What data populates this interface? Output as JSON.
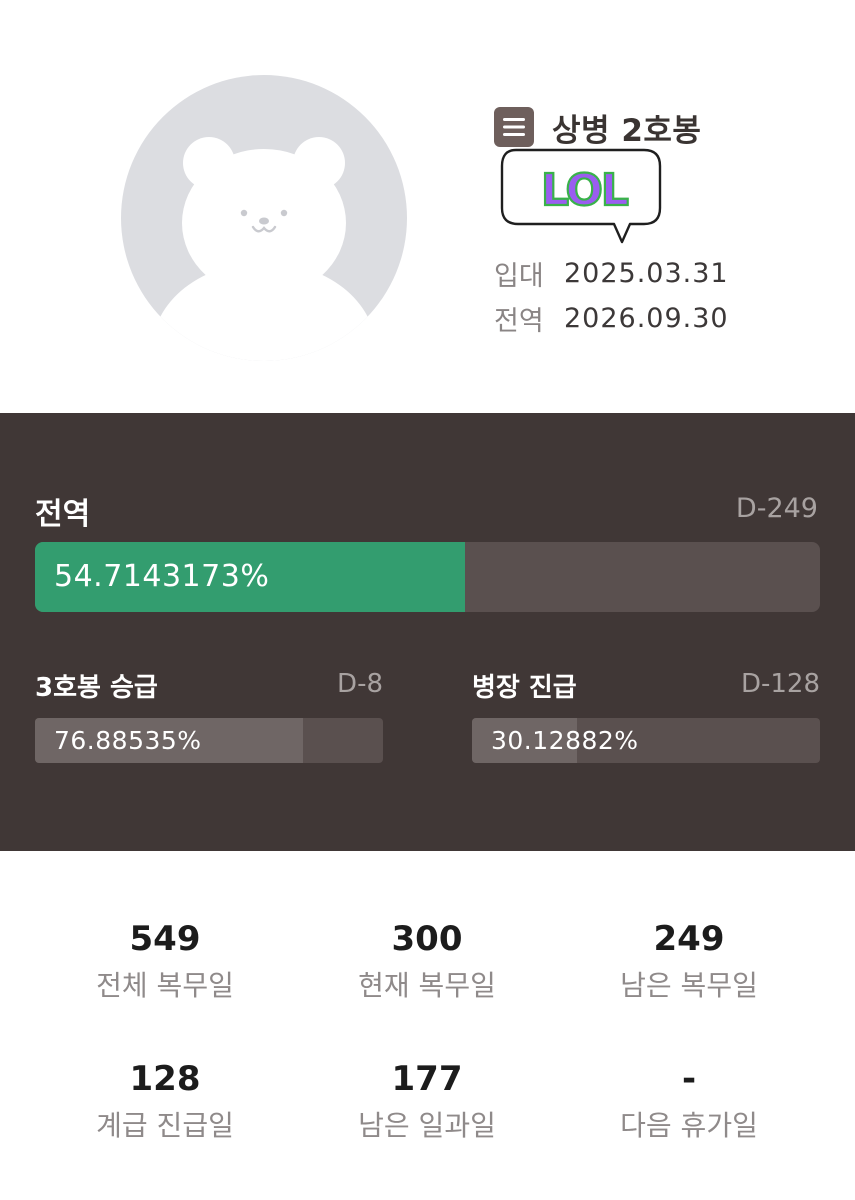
{
  "profile": {
    "rank_title": "상병 2호봉",
    "sticker_text": "LOL",
    "enlist_label": "입대",
    "enlist_date": "2025.03.31",
    "discharge_label": "전역",
    "discharge_date": "2026.09.30"
  },
  "progress": {
    "main": {
      "title": "전역",
      "dday": "D-249",
      "percent_text": "54.7143173%",
      "fraction": 0.547143173
    },
    "subs": [
      {
        "title": "3호봉 승급",
        "dday": "D-8",
        "percent_text": "76.88535%",
        "fraction": 0.7688535
      },
      {
        "title": "병장 진급",
        "dday": "D-128",
        "percent_text": "30.12882%",
        "fraction": 0.3012882
      }
    ]
  },
  "stats": [
    {
      "value": "549",
      "label": "전체 복무일"
    },
    {
      "value": "300",
      "label": "현재 복무일"
    },
    {
      "value": "249",
      "label": "남은 복무일"
    },
    {
      "value": "128",
      "label": "계급 진급일"
    },
    {
      "value": "177",
      "label": "남은 일과일"
    },
    {
      "value": "-",
      "label": "다음 휴가일"
    }
  ],
  "colors": {
    "panel_bg": "#403736",
    "progress_green": "#339d6f",
    "sub_fill": "#6f6665",
    "bar_track": "#5a504f",
    "avatar_bg": "#dcdde1",
    "sticker_purple": "#9a5df0",
    "sticker_green": "#39b24a"
  },
  "icons": {
    "menu": "hamburger-icon",
    "avatar": "bear-avatar-icon",
    "sticker": "lol-speech-bubble-sticker"
  }
}
